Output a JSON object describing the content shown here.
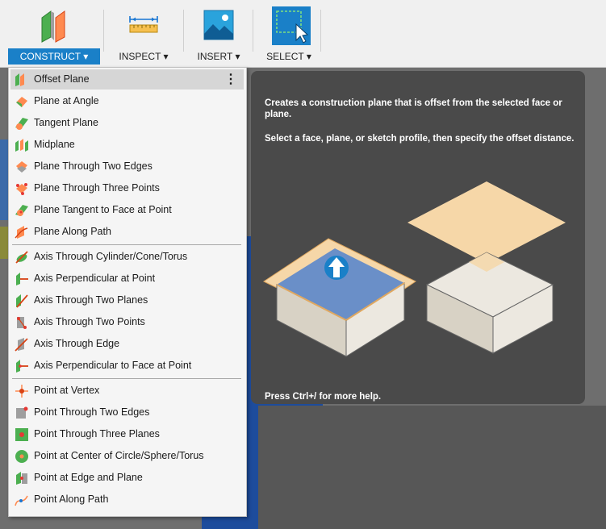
{
  "toolbar": {
    "construct": "CONSTRUCT",
    "inspect": "INSPECT",
    "insert": "INSERT",
    "select": "SELECT",
    "caret": "▾"
  },
  "menu": {
    "more_label": "⋮",
    "planes": [
      {
        "label": "Offset Plane",
        "icon": "offset-plane-icon"
      },
      {
        "label": "Plane at Angle",
        "icon": "plane-at-angle-icon"
      },
      {
        "label": "Tangent Plane",
        "icon": "tangent-plane-icon"
      },
      {
        "label": "Midplane",
        "icon": "midplane-icon"
      },
      {
        "label": "Plane Through Two Edges",
        "icon": "plane-two-edges-icon"
      },
      {
        "label": "Plane Through Three Points",
        "icon": "plane-three-points-icon"
      },
      {
        "label": "Plane Tangent to Face at Point",
        "icon": "plane-tangent-face-icon"
      },
      {
        "label": "Plane Along Path",
        "icon": "plane-along-path-icon"
      }
    ],
    "axes": [
      {
        "label": "Axis Through Cylinder/Cone/Torus",
        "icon": "axis-cylinder-icon"
      },
      {
        "label": "Axis Perpendicular at Point",
        "icon": "axis-perpendicular-icon"
      },
      {
        "label": "Axis Through Two Planes",
        "icon": "axis-two-planes-icon"
      },
      {
        "label": "Axis Through Two Points",
        "icon": "axis-two-points-icon"
      },
      {
        "label": "Axis Through Edge",
        "icon": "axis-edge-icon"
      },
      {
        "label": "Axis Perpendicular to Face at Point",
        "icon": "axis-perp-face-icon"
      }
    ],
    "points": [
      {
        "label": "Point at Vertex",
        "icon": "point-vertex-icon"
      },
      {
        "label": "Point Through Two Edges",
        "icon": "point-two-edges-icon"
      },
      {
        "label": "Point Through Three Planes",
        "icon": "point-three-planes-icon"
      },
      {
        "label": "Point at Center of Circle/Sphere/Torus",
        "icon": "point-center-icon"
      },
      {
        "label": "Point at Edge and Plane",
        "icon": "point-edge-plane-icon"
      },
      {
        "label": "Point Along Path",
        "icon": "point-along-path-icon"
      }
    ]
  },
  "tooltip": {
    "description": "Creates a construction plane that is offset from the selected face or plane.",
    "instruction": "Select a face, plane, or sketch profile, then specify the offset distance.",
    "help": "Press Ctrl+/ for more help."
  },
  "colors": {
    "accent": "#1a80c8",
    "tooltip_bg": "#4a4a4a",
    "plane_orange": "#f6d7a8",
    "face_blue": "#6a8fc8"
  }
}
